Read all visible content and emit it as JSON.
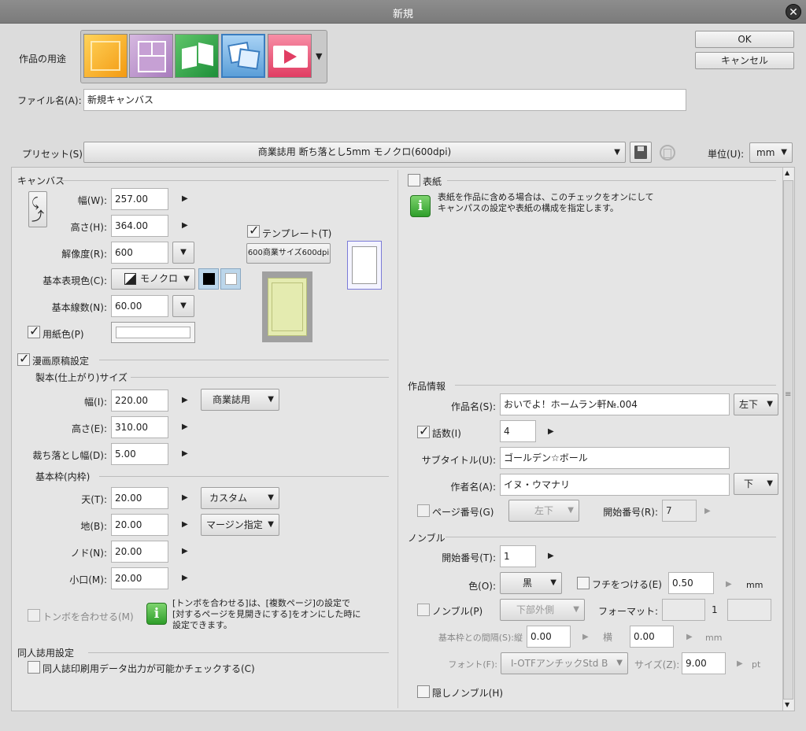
{
  "window": {
    "title": "新規"
  },
  "header": {
    "purpose_label": "作品の用途",
    "ok_label": "OK",
    "cancel_label": "キャンセル",
    "filename_label": "ファイル名(A):",
    "filename_value": "新規キャンバス",
    "preset_label": "プリセット(S):",
    "preset_value": "商業誌用 断ち落とし5mm モノクロ(600dpi)",
    "unit_label": "単位(U):",
    "unit_value": "mm"
  },
  "canvas": {
    "section_label": "キャンバス",
    "width_label": "幅(W):",
    "width_value": "257.00",
    "height_label": "高さ(H):",
    "height_value": "364.00",
    "resolution_label": "解像度(R):",
    "resolution_value": "600",
    "color_label": "基本表現色(C):",
    "color_value": "モノクロ",
    "lines_label": "基本線数(N):",
    "lines_value": "60.00",
    "paper_label": "用紙色(P)",
    "template_label": "テンプレート(T)",
    "template_button": "600商業サイズ600dpi"
  },
  "manga": {
    "section_label": "漫画原稿設定",
    "bind_label": "製本(仕上がり)サイズ",
    "width_label": "幅(I):",
    "width_value": "220.00",
    "width_preset": "商業誌用",
    "height_label": "高さ(E):",
    "height_value": "310.00",
    "bleed_label": "裁ち落とし幅(D):",
    "bleed_value": "5.00",
    "frame_label": "基本枠(内枠)",
    "top_label": "天(T):",
    "top_value": "20.00",
    "top_preset": "カスタム",
    "bottom_label": "地(B):",
    "bottom_value": "20.00",
    "bottom_preset": "マージン指定",
    "gutter_label": "ノド(N):",
    "gutter_value": "20.00",
    "fore_label": "小口(M):",
    "fore_value": "20.00",
    "tombo_label": "トンボを合わせる(M)",
    "tombo_info_lines": [
      "[トンボを合わせる]は、[複数ページ]の設定で",
      "[対するページを見開きにする]をオンにした時に",
      "設定できます。"
    ]
  },
  "doujin": {
    "section_label": "同人誌用設定",
    "check_label": "同人誌印刷用データ出力が可能かチェックする(C)"
  },
  "cover": {
    "label": "表紙",
    "info_lines": [
      "表紙を作品に含める場合は、このチェックをオンにして",
      "キャンパスの設定や表紙の構成を指定します。"
    ]
  },
  "work_info": {
    "section_label": "作品情報",
    "title_label": "作品名(S):",
    "title_value": "おいでよ！ホームラン軒№.004",
    "title_pos": "左下",
    "episode_label": "話数(I)",
    "episode_value": "4",
    "subtitle_label": "サブタイトル(U):",
    "subtitle_value": "ゴールデン☆ボール",
    "author_label": "作者名(A):",
    "author_value": "イヌ・ウマナリ",
    "author_pos": "下",
    "page_no_label": "ページ番号(G)",
    "page_no_pos": "左下",
    "start_label": "開始番号(R):",
    "start_value": "7"
  },
  "nombre": {
    "section_label": "ノンブル",
    "start_label": "開始番号(T):",
    "start_value": "1",
    "color_label": "色(O):",
    "color_value": "黒",
    "border_label": "フチをつける(E)",
    "border_value": "0.50",
    "border_unit": "mm",
    "nombre_label": "ノンブル(P)",
    "nombre_pos": "下部外側",
    "format_label": "フォーマット:",
    "format_mid": "1",
    "gap_label": "基本枠との間隔(S):縦",
    "gap_v": "0.00",
    "gap_h_label": "横",
    "gap_h": "0.00",
    "gap_unit": "mm",
    "font_label": "フォント(F):",
    "font_value": "I-OTFアンチックStd B",
    "size_label": "サイズ(Z):",
    "size_value": "9.00",
    "size_unit": "pt",
    "hidden_label": "隠しノンブル(H)"
  },
  "colors": {
    "accent_blue": "#5b9fd8",
    "panel": "#e5e5e5",
    "info_green": "#3aa832",
    "paper_yellow": "#e4ebb0"
  }
}
